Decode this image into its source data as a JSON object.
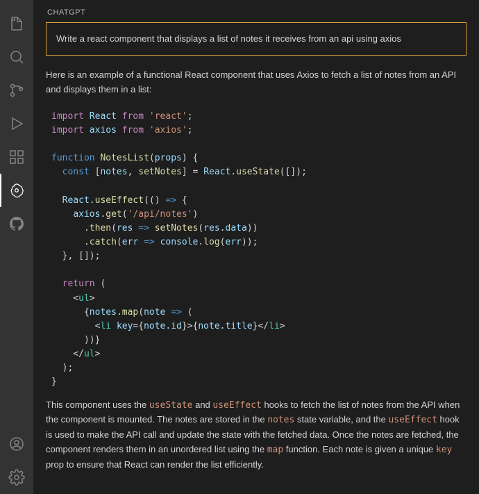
{
  "panel": {
    "title": "CHATGPT"
  },
  "prompt": "Write a react component that displays a list of notes it receives from an api using axios",
  "intro": "Here is an example of a functional React component that uses Axios to fetch a list of notes from an API and displays them in a list:",
  "explanation": {
    "p1_a": "This component uses the ",
    "c_useState": "useState",
    "p1_b": " and ",
    "c_useEffect": "useEffect",
    "p1_c": " hooks to fetch the list of notes from the API when the component is mounted. The notes are stored in the ",
    "c_notes": "notes",
    "p1_d": " state variable, and the ",
    "c_useEffect2": "useEffect",
    "p1_e": " hook is used to make the API call and update the state with the fetched data. Once the notes are fetched, the component renders them in an unordered list using the ",
    "c_map": "map",
    "p1_f": " function. Each note is given a unique ",
    "c_key": "key",
    "p1_g": " prop to ensure that React can render the list efficiently."
  },
  "code": {
    "import": "import",
    "react_id": "React",
    "from": "from",
    "react_str": "'react'",
    "axios_id": "axios",
    "axios_str": "'axios'",
    "function": "function",
    "fn_name": "NotesList",
    "props": "props",
    "const": "const",
    "notes": "notes",
    "setNotes": "setNotes",
    "useState": "useState",
    "useEffect": "useEffect",
    "get": "get",
    "api_str": "'/api/notes'",
    "then": "then",
    "res": "res",
    "data": "data",
    "catch": "catch",
    "err": "err",
    "console": "console",
    "log": "log",
    "return": "return",
    "ul": "ul",
    "map": "map",
    "note": "note",
    "li": "li",
    "key": "key",
    "id": "id",
    "title": "title"
  }
}
